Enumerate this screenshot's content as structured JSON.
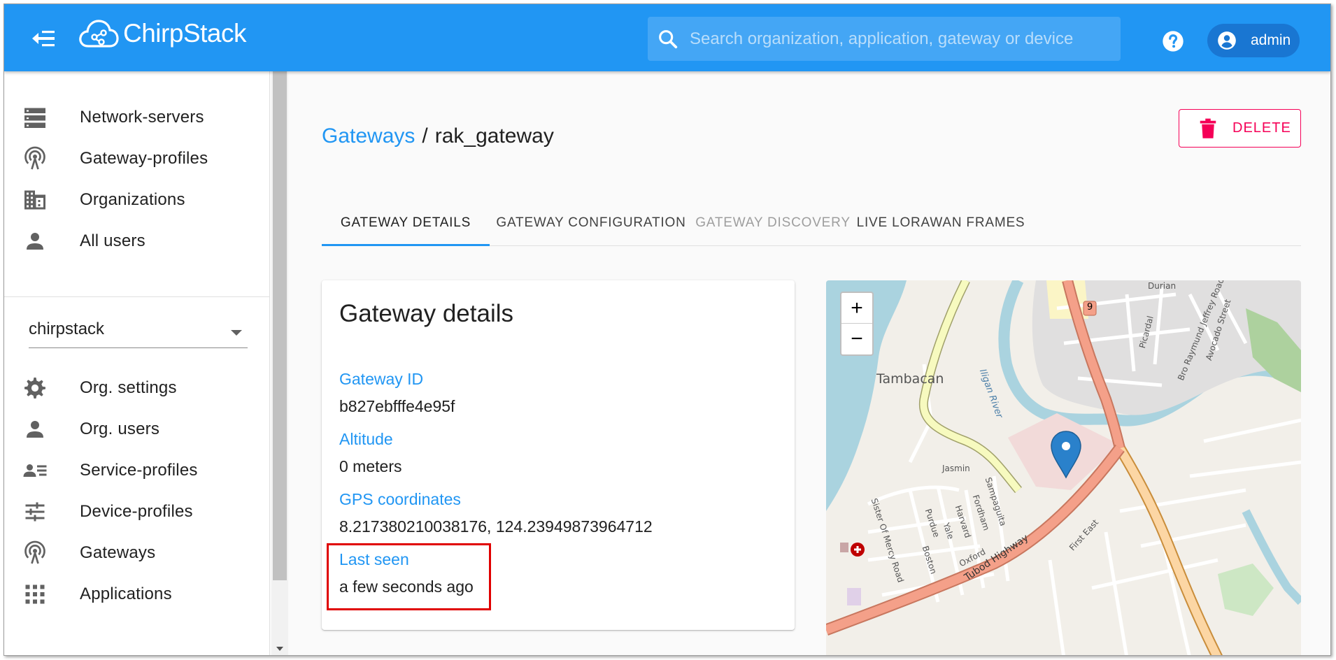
{
  "appbar": {
    "logo_text": "ChirpStack",
    "search_placeholder": "Search organization, application, gateway or device",
    "user_label": "admin"
  },
  "sidebar": {
    "admin_items": [
      {
        "label": "Network-servers",
        "icon": "server-icon"
      },
      {
        "label": "Gateway-profiles",
        "icon": "gateway-icon"
      },
      {
        "label": "Organizations",
        "icon": "building-icon"
      },
      {
        "label": "All users",
        "icon": "person-icon"
      }
    ],
    "org_selector": "chirpstack",
    "org_items": [
      {
        "label": "Org. settings",
        "icon": "gear-icon"
      },
      {
        "label": "Org. users",
        "icon": "person-icon"
      },
      {
        "label": "Service-profiles",
        "icon": "account-details-icon"
      },
      {
        "label": "Device-profiles",
        "icon": "tune-icon"
      },
      {
        "label": "Gateways",
        "icon": "gateway-icon"
      },
      {
        "label": "Applications",
        "icon": "apps-grid-icon"
      }
    ]
  },
  "page": {
    "breadcrumb_link": "Gateways",
    "breadcrumb_sep": "/",
    "breadcrumb_current": "rak_gateway",
    "delete_label": "DELETE"
  },
  "tabs": [
    {
      "label": "GATEWAY DETAILS",
      "state": "active"
    },
    {
      "label": "GATEWAY CONFIGURATION",
      "state": "normal"
    },
    {
      "label": "GATEWAY DISCOVERY",
      "state": "disabled"
    },
    {
      "label": "LIVE LORAWAN FRAMES",
      "state": "normal"
    }
  ],
  "details": {
    "title": "Gateway details",
    "gateway_id_label": "Gateway ID",
    "gateway_id": "b827ebfffe4e95f",
    "altitude_label": "Altitude",
    "altitude": "0 meters",
    "gps_label": "GPS coordinates",
    "gps": "8.217380210038176, 124.23949873964712",
    "last_seen_label": "Last seen",
    "last_seen": "a few seconds ago"
  },
  "map": {
    "zoom_in": "+",
    "zoom_out": "−",
    "labels": {
      "tambacan": "Tambacan",
      "iligan_river": "Iligan River",
      "jasmin": "Jasmin",
      "sampaguita": "Sampaguita",
      "fordham": "Fordham",
      "harvard": "Harvard",
      "yale": "Yale",
      "purdue": "Purdue",
      "boston": "Boston",
      "oxford": "Oxford",
      "sister_of_mercy": "Sister Of Mercy Road",
      "tubod_highway": "Tubod Highway",
      "first_east": "First East",
      "durian": "Durian",
      "picardal": "Picardal",
      "bro_raymund": "Bro Raymund Jeffrey Road",
      "avocado": "Avocado Street",
      "route_9": "9"
    }
  },
  "colors": {
    "primary": "#2196f3",
    "delete": "#f50057",
    "highlight": "#e00000"
  }
}
